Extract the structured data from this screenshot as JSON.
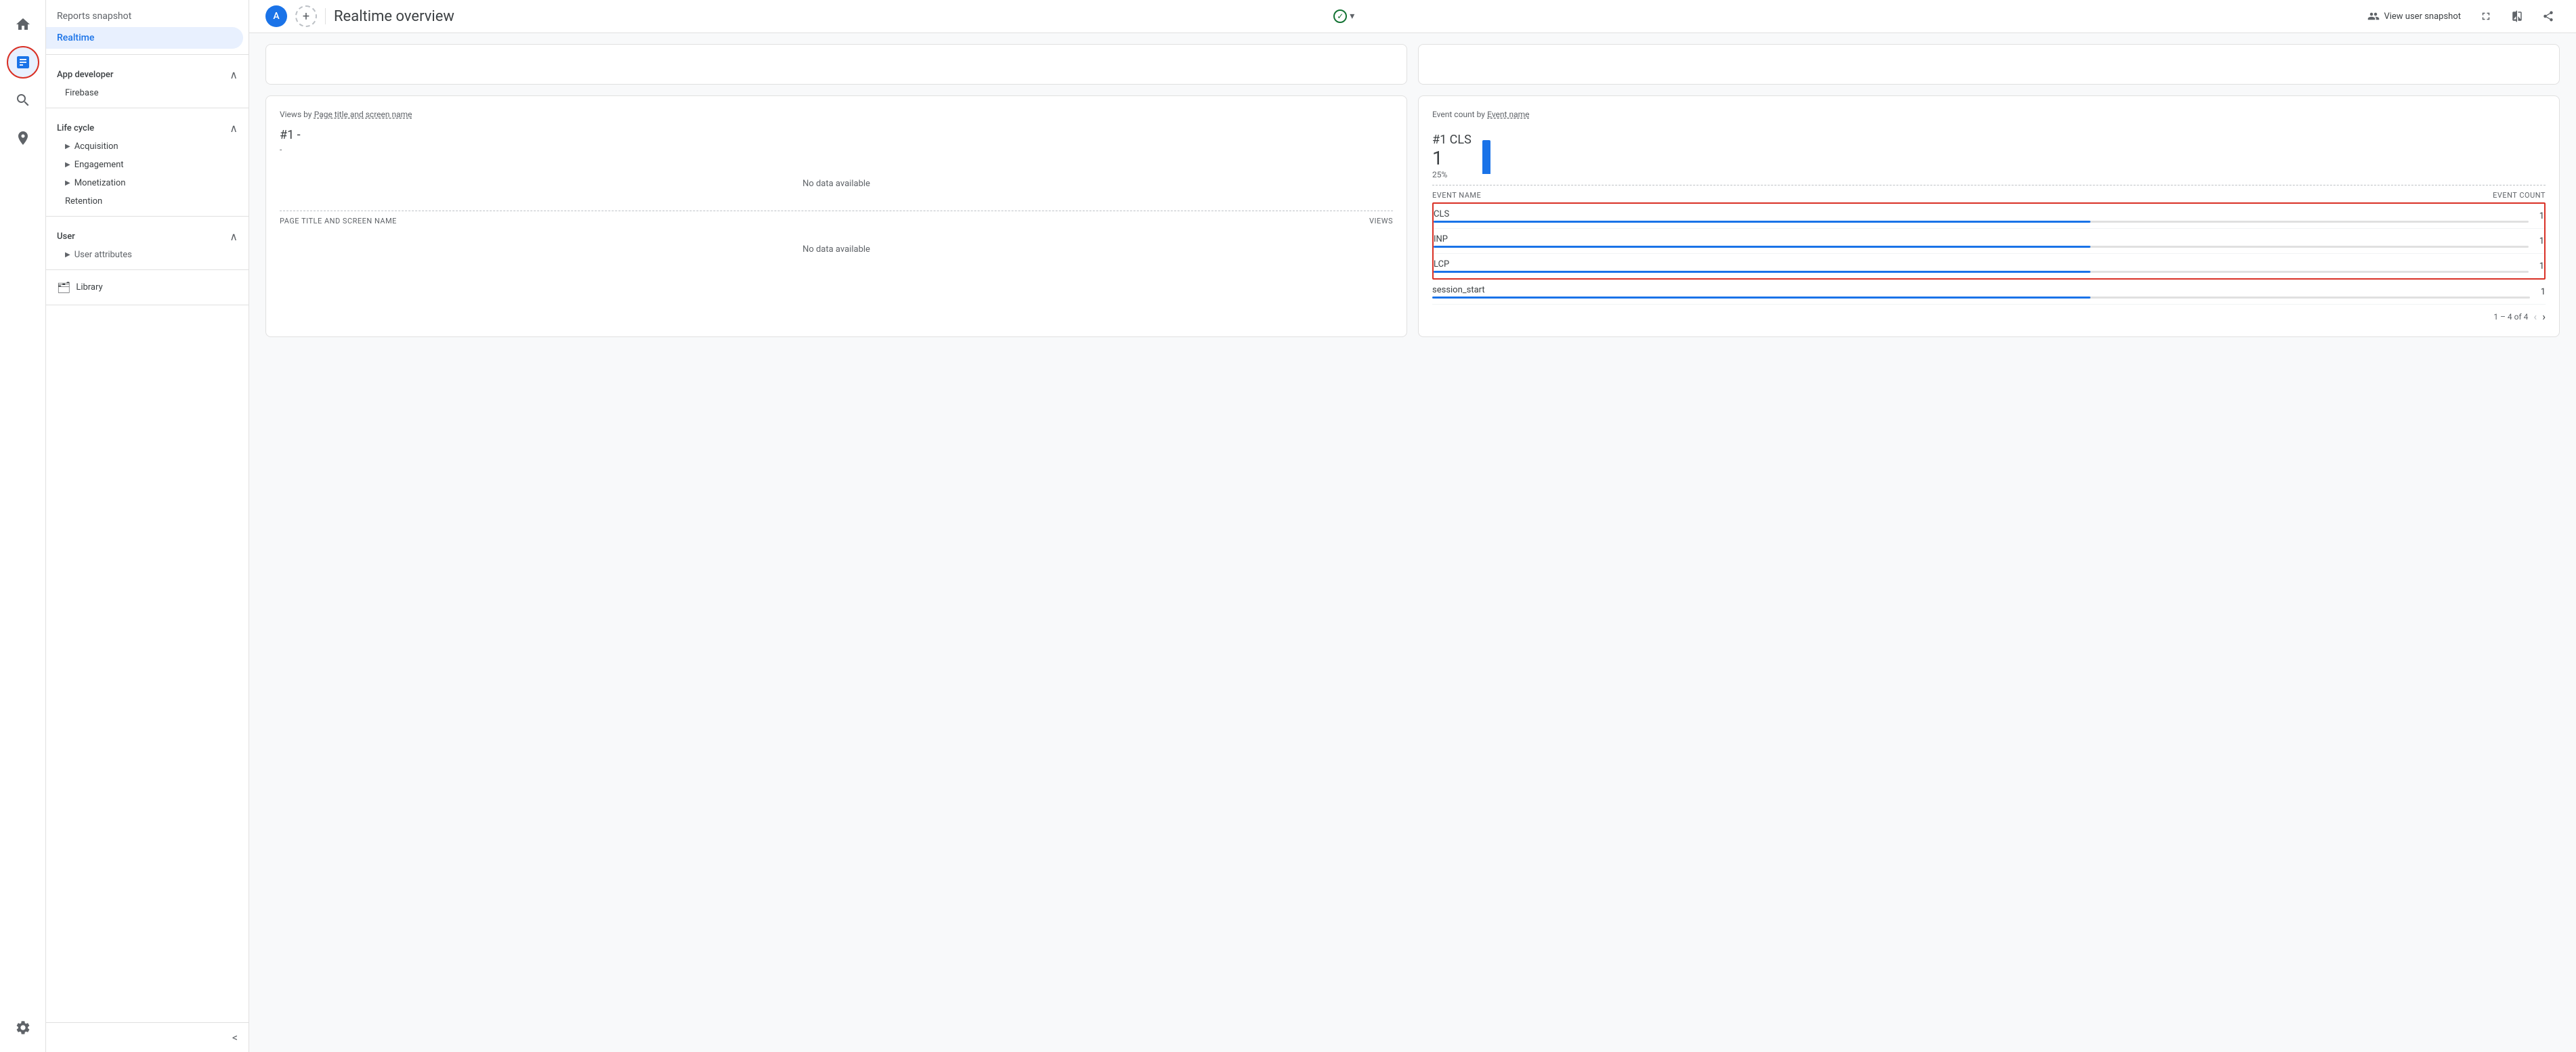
{
  "iconNav": {
    "items": [
      {
        "name": "home-icon",
        "icon": "🏠",
        "active": false
      },
      {
        "name": "reports-icon",
        "icon": "📊",
        "active": true
      },
      {
        "name": "search-icon",
        "icon": "🔍",
        "active": false
      },
      {
        "name": "explore-icon",
        "icon": "📡",
        "active": false
      }
    ],
    "bottomItems": [
      {
        "name": "settings-icon",
        "icon": "⚙️"
      }
    ]
  },
  "sidebar": {
    "header": "Reports snapshot",
    "activeItem": "Realtime",
    "sections": [
      {
        "label": "App developer",
        "collapsed": false,
        "items": [
          {
            "label": "Firebase",
            "indent": true
          }
        ]
      },
      {
        "label": "Life cycle",
        "collapsed": false,
        "items": [
          {
            "label": "Acquisition",
            "hasArrow": true
          },
          {
            "label": "Engagement",
            "hasArrow": true
          },
          {
            "label": "Monetization",
            "hasArrow": true
          },
          {
            "label": "Retention",
            "hasArrow": false
          }
        ]
      },
      {
        "label": "User",
        "collapsed": false,
        "items": [
          {
            "label": "User attributes",
            "hasArrow": true
          }
        ]
      }
    ],
    "library": "Library",
    "collapseLabel": "<"
  },
  "topbar": {
    "avatarLetter": "A",
    "addButtonLabel": "+",
    "pageTitle": "Realtime overview",
    "statusLabel": "✓",
    "dropdownArrow": "▾",
    "actions": [
      {
        "name": "view-user-snapshot",
        "label": "View user snapshot",
        "icon": "👤"
      },
      {
        "name": "fullscreen",
        "icon": "⛶"
      },
      {
        "name": "compare",
        "icon": "▐▌"
      },
      {
        "name": "share",
        "icon": "↗"
      }
    ]
  },
  "viewsCard": {
    "titlePart1": "Views by",
    "titleLink1": "Page title and screen name",
    "rank": "#1 -",
    "sub": "-",
    "noDataCenter": "No data available",
    "tableHeader": {
      "left": "PAGE TITLE AND SCREEN NAME",
      "right": "VIEWS"
    },
    "noDataTable": "No data available"
  },
  "eventCard": {
    "titlePart1": "Event count by",
    "titleLink1": "Event name",
    "rank": "#1 CLS",
    "count": "1",
    "percent": "25%",
    "barHeight": 50,
    "tableHeader": {
      "left": "EVENT NAME",
      "right": "EVENT COUNT"
    },
    "rows": [
      {
        "name": "CLS",
        "count": "1",
        "barWidth": 100,
        "highlighted": true
      },
      {
        "name": "INP",
        "count": "1",
        "barWidth": 100,
        "highlighted": true
      },
      {
        "name": "LCP",
        "count": "1",
        "barWidth": 100,
        "highlighted": true
      },
      {
        "name": "session_start",
        "count": "1",
        "barWidth": 100,
        "highlighted": false
      }
    ],
    "pagination": "1 – 4 of 4"
  }
}
